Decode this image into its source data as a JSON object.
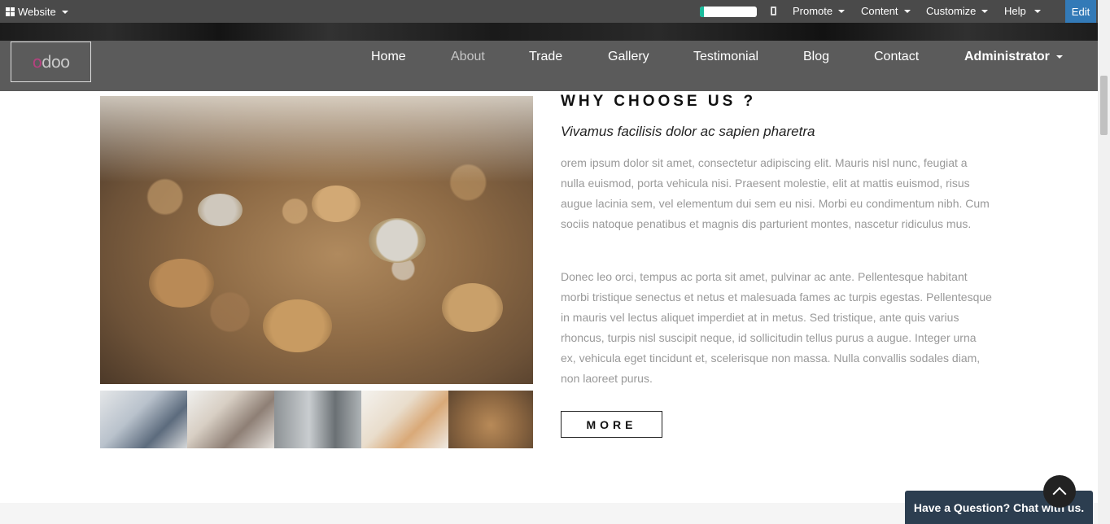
{
  "admin_bar": {
    "website_label": "Website",
    "progress_fraction": 0.07,
    "menus": [
      "Promote",
      "Content",
      "Customize",
      "Help"
    ],
    "edit_label": "Edit"
  },
  "navbar": {
    "logo": "odoo",
    "items": [
      "Home",
      "About",
      "Trade",
      "Gallery",
      "Testimonial",
      "Blog",
      "Contact"
    ],
    "active_item": "About",
    "admin_label": "Administrator"
  },
  "section": {
    "title": "WHY CHOOSE US ?",
    "subtitle": "Vivamus facilisis dolor ac sapien pharetra",
    "paragraph1": "orem ipsum dolor sit amet, consectetur adipiscing elit. Mauris nisl nunc, feugiat a nulla euismod, porta vehicula nisi. Praesent molestie, elit at mattis euismod, risus augue lacinia sem, vel elementum dui sem eu nisi. Morbi eu condimentum nibh. Cum sociis natoque penatibus et magnis dis parturient montes, nascetur ridiculus mus.",
    "paragraph2": "Donec leo orci, tempus ac porta sit amet, pulvinar ac ante. Pellentesque habitant morbi tristique senectus et netus et malesuada fames ac turpis egestas. Pellentesque in mauris vel lectus aliquet imperdiet at in metus. Sed tristique, ante quis varius rhoncus, turpis nisl suscipit neque, id sollicitudin tellus purus a augue. Integer urna ex, vehicula eget tincidunt et, scelerisque non massa. Nulla convallis sodales diam, non laoreet purus.",
    "more_label": "MORE"
  },
  "gallery": {
    "thumbnails": [
      "team-meeting",
      "office-group",
      "atm-cash",
      "euro-banknotes",
      "coins"
    ]
  },
  "chat": {
    "label": "Have a Question? Chat with us."
  },
  "colors": {
    "admin_bar": "#4a4a4a",
    "navbar": "#5b5b5b",
    "edit_button": "#337ab7",
    "chat": "#2c3e50",
    "progress": "#1abc9c"
  }
}
